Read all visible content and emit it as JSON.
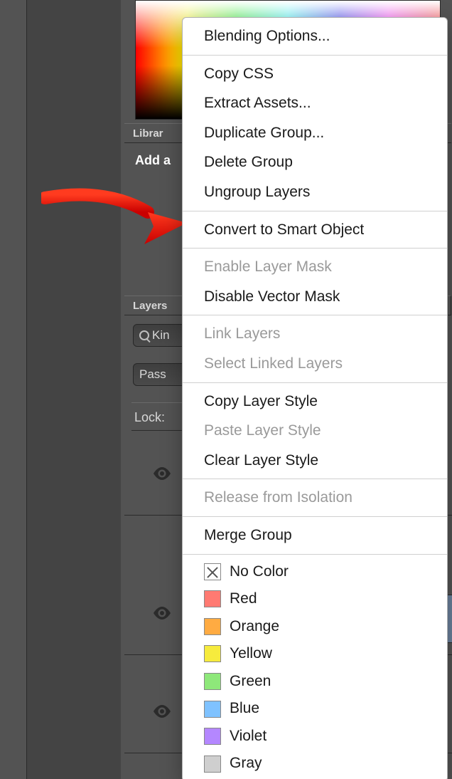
{
  "panels": {
    "libraries_tab": "Librar",
    "add_label": "Add a",
    "layers_tab": "Layers",
    "kind_label": "Kin",
    "pass_label": "Pass",
    "lock_label": "Lock:"
  },
  "menu": {
    "blending_options": "Blending Options...",
    "copy_css": "Copy CSS",
    "extract_assets": "Extract Assets...",
    "duplicate_group": "Duplicate Group...",
    "delete_group": "Delete Group",
    "ungroup_layers": "Ungroup Layers",
    "convert_smart": "Convert to Smart Object",
    "enable_layer_mask": "Enable Layer Mask",
    "disable_vector_mask": "Disable Vector Mask",
    "link_layers": "Link Layers",
    "select_linked": "Select Linked Layers",
    "copy_layer_style": "Copy Layer Style",
    "paste_layer_style": "Paste Layer Style",
    "clear_layer_style": "Clear Layer Style",
    "release_isolation": "Release from Isolation",
    "merge_group": "Merge Group",
    "colors": {
      "none": {
        "label": "No Color",
        "hex": "#ffffff"
      },
      "red": {
        "label": "Red",
        "hex": "#ff7a72"
      },
      "orange": {
        "label": "Orange",
        "hex": "#ffab42"
      },
      "yellow": {
        "label": "Yellow",
        "hex": "#f6eb3d"
      },
      "green": {
        "label": "Green",
        "hex": "#8ee87a"
      },
      "blue": {
        "label": "Blue",
        "hex": "#7fc2ff"
      },
      "violet": {
        "label": "Violet",
        "hex": "#b487ff"
      },
      "gray": {
        "label": "Gray",
        "hex": "#cfcfcf"
      }
    }
  }
}
